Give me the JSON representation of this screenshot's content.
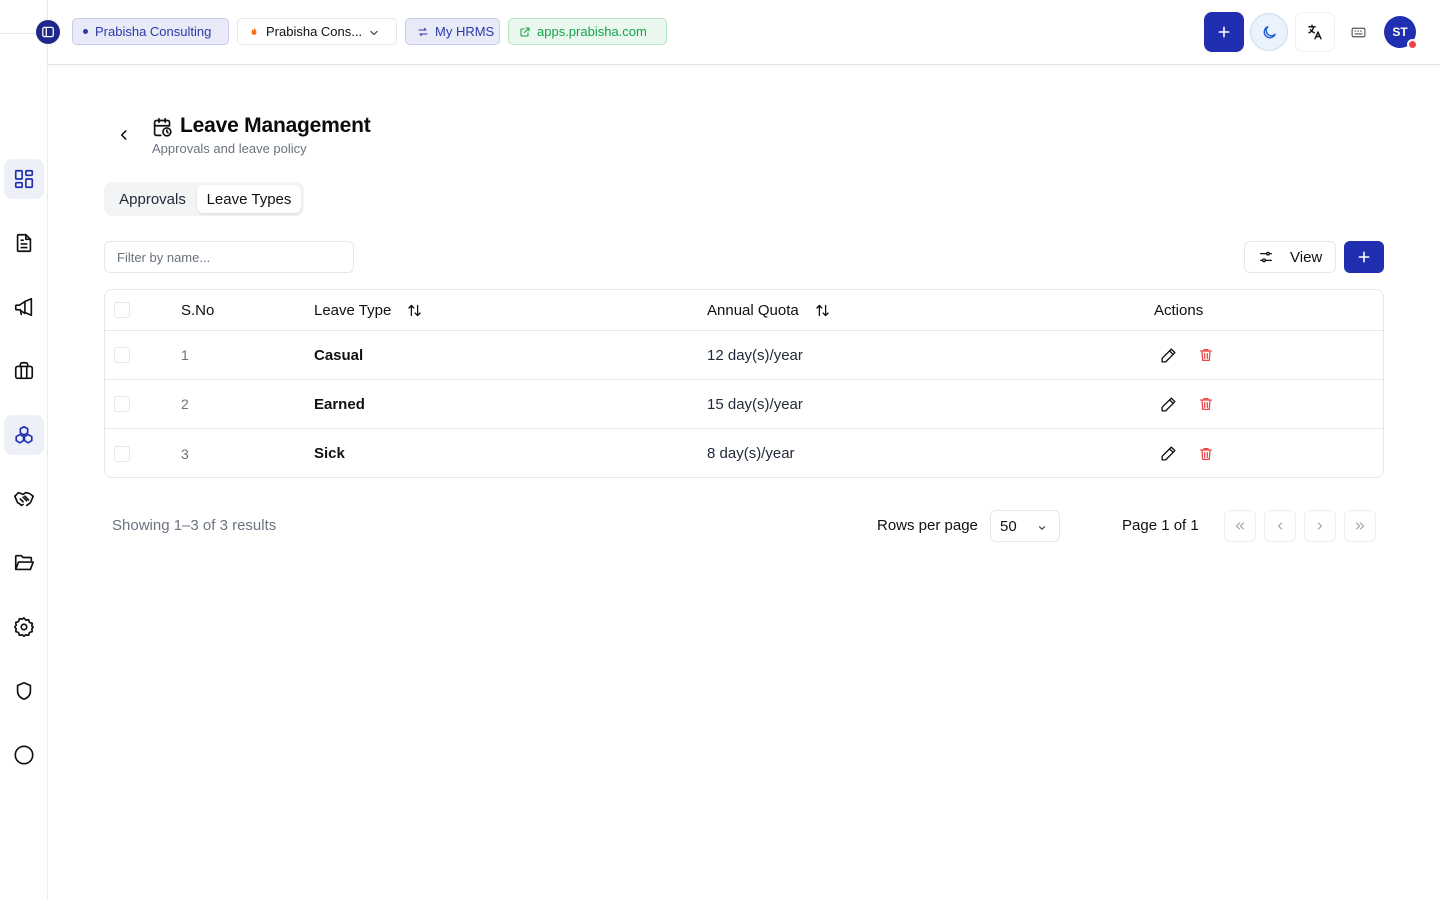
{
  "header": {
    "org_chip": "Prabisha Consulting",
    "company_select": "Prabisha Cons...",
    "app_chip": "My HRMS",
    "site_chip": "apps.prabisha.com",
    "avatar_initials": "ST"
  },
  "sidebar": {
    "items": [
      {
        "icon": "dashboard-icon",
        "active": true
      },
      {
        "icon": "document-icon",
        "active": false
      },
      {
        "icon": "megaphone-icon",
        "active": false
      },
      {
        "icon": "briefcase-icon",
        "active": false
      },
      {
        "icon": "boxes-icon",
        "active": true
      },
      {
        "icon": "handshake-icon",
        "active": false
      },
      {
        "icon": "folder-open-icon",
        "active": false
      },
      {
        "icon": "settings-icon",
        "active": false
      },
      {
        "icon": "shield-icon",
        "active": false
      },
      {
        "icon": "circle-icon",
        "active": false
      }
    ]
  },
  "page": {
    "title": "Leave Management",
    "subtitle": "Approvals and leave policy"
  },
  "tabs": [
    {
      "label": "Approvals",
      "selected": false
    },
    {
      "label": "Leave Types",
      "selected": true
    }
  ],
  "toolbar": {
    "filter_placeholder": "Filter by name...",
    "filter_value": "",
    "view_label": "View"
  },
  "table": {
    "columns": [
      "S.No",
      "Leave Type",
      "Annual Quota",
      "Actions"
    ],
    "rows": [
      {
        "sno": "1",
        "leave_type": "Casual",
        "quota": "12 day(s)/year"
      },
      {
        "sno": "2",
        "leave_type": "Earned",
        "quota": "15 day(s)/year"
      },
      {
        "sno": "3",
        "leave_type": "Sick",
        "quota": "8 day(s)/year"
      }
    ]
  },
  "footer": {
    "showing": "Showing 1–3 of 3 results",
    "rows_per_page_label": "Rows per page",
    "rows_per_page_value": "50",
    "page_info": "Page 1 of 1"
  },
  "colors": {
    "primary": "#1f2fb0",
    "delete": "#ef4444",
    "site_chip": "#16a34a"
  }
}
